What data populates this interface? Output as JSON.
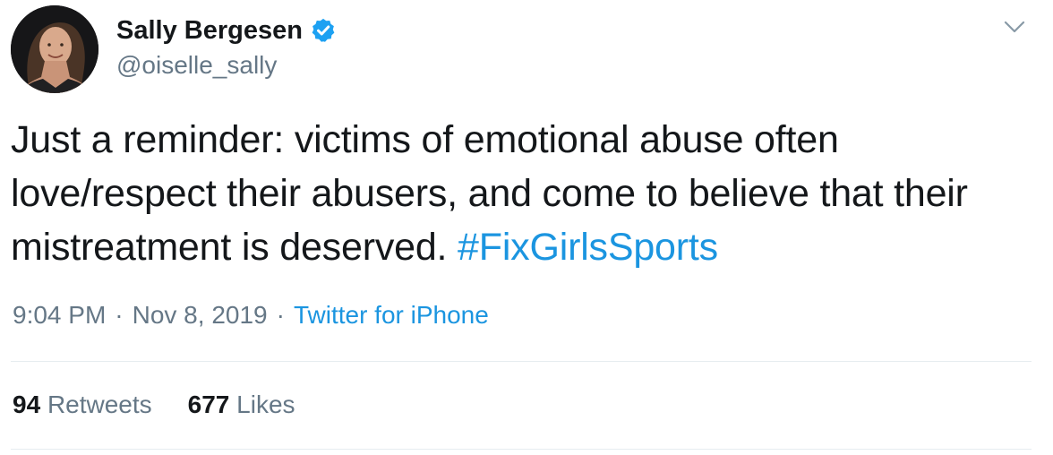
{
  "author": {
    "display_name": "Sally Bergesen",
    "handle": "@oiselle_sally",
    "verified": true
  },
  "tweet": {
    "text": "Just a reminder: victims of emotional abuse often love/respect their abusers, and come to believe that their mistreatment is deserved. ",
    "hashtag": "#FixGirlsSports",
    "time": "9:04 PM",
    "date": "Nov 8, 2019",
    "separator": "·",
    "source": "Twitter for iPhone"
  },
  "stats": {
    "retweets_count": "94",
    "retweets_label": "Retweets",
    "likes_count": "677",
    "likes_label": "Likes"
  },
  "icons": {
    "verified": "verified-badge-icon",
    "menu": "chevron-down-icon"
  },
  "colors": {
    "link": "#1b95e0",
    "secondary_text": "#657786",
    "primary_text": "#14171a",
    "divider": "#e6ecf0"
  }
}
